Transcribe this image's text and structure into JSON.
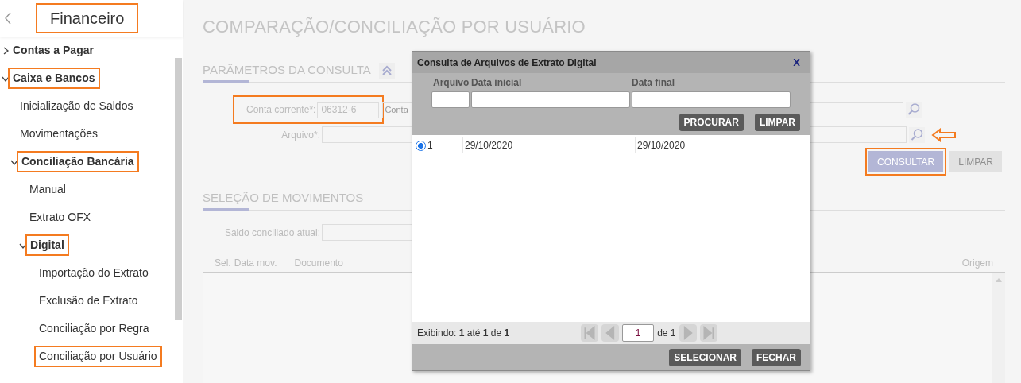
{
  "sidebar": {
    "title": "Financeiro",
    "title_highlighted": true,
    "items": [
      {
        "label": "Contas a Pagar",
        "bold": true,
        "expanded": false,
        "highlighted": false
      },
      {
        "label": "Caixa e Bancos",
        "bold": true,
        "expanded": true,
        "highlighted": true,
        "children": [
          {
            "label": "Inicialização de Saldos",
            "bold": false,
            "highlighted": false
          },
          {
            "label": "Movimentações",
            "bold": false,
            "highlighted": false
          },
          {
            "label": "Conciliação Bancária",
            "bold": true,
            "expanded": true,
            "highlighted": true,
            "children": [
              {
                "label": "Manual",
                "bold": false,
                "highlighted": false
              },
              {
                "label": "Extrato OFX",
                "bold": false,
                "highlighted": false
              },
              {
                "label": "Digital",
                "bold": true,
                "expanded": true,
                "highlighted": true,
                "children": [
                  {
                    "label": "Importação do Extrato",
                    "bold": false,
                    "highlighted": false
                  },
                  {
                    "label": "Exclusão de Extrato",
                    "bold": false,
                    "highlighted": false
                  },
                  {
                    "label": "Conciliação por Regra",
                    "bold": false,
                    "highlighted": false
                  },
                  {
                    "label": "Conciliação por Usuário",
                    "bold": false,
                    "highlighted": true
                  }
                ]
              }
            ]
          }
        ]
      }
    ]
  },
  "page_title": "COMPARAÇÃO/CONCILIAÇÃO POR USUÁRIO",
  "parameters": {
    "heading": "PARÂMETROS DA CONSULTA",
    "account": {
      "label": "Conta corrente*:",
      "value": "06312-6",
      "name_value": "Conta",
      "highlighted": true
    },
    "file": {
      "label": "Arquivo*:",
      "arrow": true
    },
    "buttons": [
      {
        "label": "CONSULTAR",
        "disabled": false,
        "highlighted": true
      },
      {
        "label": "LIMPAR",
        "disabled": true,
        "highlighted": false
      }
    ]
  },
  "movements": {
    "heading": "SELEÇÃO DE MOVIMENTOS",
    "balance_label": "Saldo conciliado atual:",
    "columns": [
      "Sel.",
      "Data mov.",
      "Documento",
      "Origem"
    ]
  },
  "dialog": {
    "title": "Consulta de Arquivos de Extrato Digital",
    "close": "X",
    "filters": [
      "Arquivo",
      "Data inicial",
      "Data final"
    ],
    "filter_buttons": [
      "PROCURAR",
      "LIMPAR"
    ],
    "rows": [
      {
        "selected": true,
        "cells": [
          "1",
          "29/10/2020",
          "29/10/2020"
        ]
      }
    ],
    "status": "Exibindo: **1** até **1** de **1**",
    "page": "1",
    "page_total": "de 1",
    "buttons": [
      "SELECIONAR",
      "FECHAR"
    ]
  }
}
